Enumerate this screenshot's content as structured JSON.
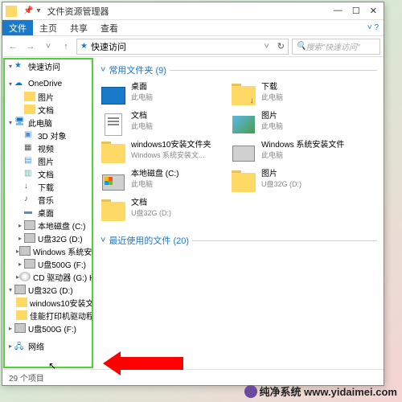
{
  "window": {
    "title": "文件资源管理器",
    "controls": {
      "min": "—",
      "max": "☐",
      "close": "✕",
      "help": "?"
    }
  },
  "ribbon": {
    "file": "文件",
    "home": "主页",
    "share": "共享",
    "view": "查看"
  },
  "nav": {
    "breadcrumb": "快速访问",
    "searchPlaceholder": "搜索\"快速访问\"",
    "refresh": "↻"
  },
  "sidebar": [
    {
      "label": "快速访问",
      "icon": "star",
      "depth": 0,
      "exp": "▾"
    },
    {
      "label": "",
      "icon": "",
      "depth": 0,
      "exp": ""
    },
    {
      "label": "OneDrive",
      "icon": "cloud",
      "depth": 0,
      "exp": "▾"
    },
    {
      "label": "图片",
      "icon": "folder",
      "depth": 1,
      "exp": ""
    },
    {
      "label": "文档",
      "icon": "folder",
      "depth": 1,
      "exp": ""
    },
    {
      "label": "此电脑",
      "icon": "pc",
      "depth": 0,
      "exp": "▾"
    },
    {
      "label": "3D 对象",
      "icon": "3d",
      "depth": 1,
      "exp": ""
    },
    {
      "label": "视频",
      "icon": "video",
      "depth": 1,
      "exp": ""
    },
    {
      "label": "图片",
      "icon": "pic",
      "depth": 1,
      "exp": ""
    },
    {
      "label": "文档",
      "icon": "doc",
      "depth": 1,
      "exp": ""
    },
    {
      "label": "下载",
      "icon": "dl",
      "depth": 1,
      "exp": ""
    },
    {
      "label": "音乐",
      "icon": "music",
      "depth": 1,
      "exp": ""
    },
    {
      "label": "桌面",
      "icon": "desk",
      "depth": 1,
      "exp": ""
    },
    {
      "label": "本地磁盘 (C:)",
      "icon": "disk",
      "depth": 1,
      "exp": "▸"
    },
    {
      "label": "U盘32G (D:)",
      "icon": "usb",
      "depth": 1,
      "exp": "▸"
    },
    {
      "label": "Windows 系统安",
      "icon": "disk",
      "depth": 1,
      "exp": "▸"
    },
    {
      "label": "U盘500G (F:)",
      "icon": "usb",
      "depth": 1,
      "exp": "▸"
    },
    {
      "label": "CD 驱动器 (G:) HiS",
      "icon": "cd",
      "depth": 1,
      "exp": "▸"
    },
    {
      "label": "U盘32G (D:)",
      "icon": "usb",
      "depth": 0,
      "exp": "▾"
    },
    {
      "label": "windows10安装文",
      "icon": "folder",
      "depth": 1,
      "exp": ""
    },
    {
      "label": "佳能打印机驱动程",
      "icon": "folder",
      "depth": 1,
      "exp": ""
    },
    {
      "label": "U盘500G (F:)",
      "icon": "usb",
      "depth": 0,
      "exp": "▸"
    },
    {
      "label": "",
      "icon": "",
      "depth": 0,
      "exp": ""
    },
    {
      "label": "网络",
      "icon": "net",
      "depth": 0,
      "exp": "▸"
    }
  ],
  "sections": {
    "frequent": {
      "title": "常用文件夹 (9)",
      "count": 9
    },
    "recent": {
      "title": "最近使用的文件 (20)",
      "count": 20
    }
  },
  "folders": [
    {
      "name": "桌面",
      "sub": "此电脑",
      "icon": "desk"
    },
    {
      "name": "下载",
      "sub": "此电脑",
      "icon": "dl"
    },
    {
      "name": "文档",
      "sub": "此电脑",
      "icon": "doc"
    },
    {
      "name": "图片",
      "sub": "此电脑",
      "icon": "pic"
    },
    {
      "name": "windows10安装文件夹",
      "sub": "Windows 系统安装文...",
      "icon": "folder"
    },
    {
      "name": "Windows 系统安装文件",
      "sub": "此电脑",
      "icon": "disk"
    },
    {
      "name": "本地磁盘 (C:)",
      "sub": "此电脑",
      "icon": "diskwin"
    },
    {
      "name": "图片",
      "sub": "U盘32G (D:)",
      "icon": "folder"
    },
    {
      "name": "文档",
      "sub": "U盘32G (D:)",
      "icon": "folder"
    }
  ],
  "status": "29 个项目",
  "watermark": "纯净系统 www.yidaimei.com"
}
